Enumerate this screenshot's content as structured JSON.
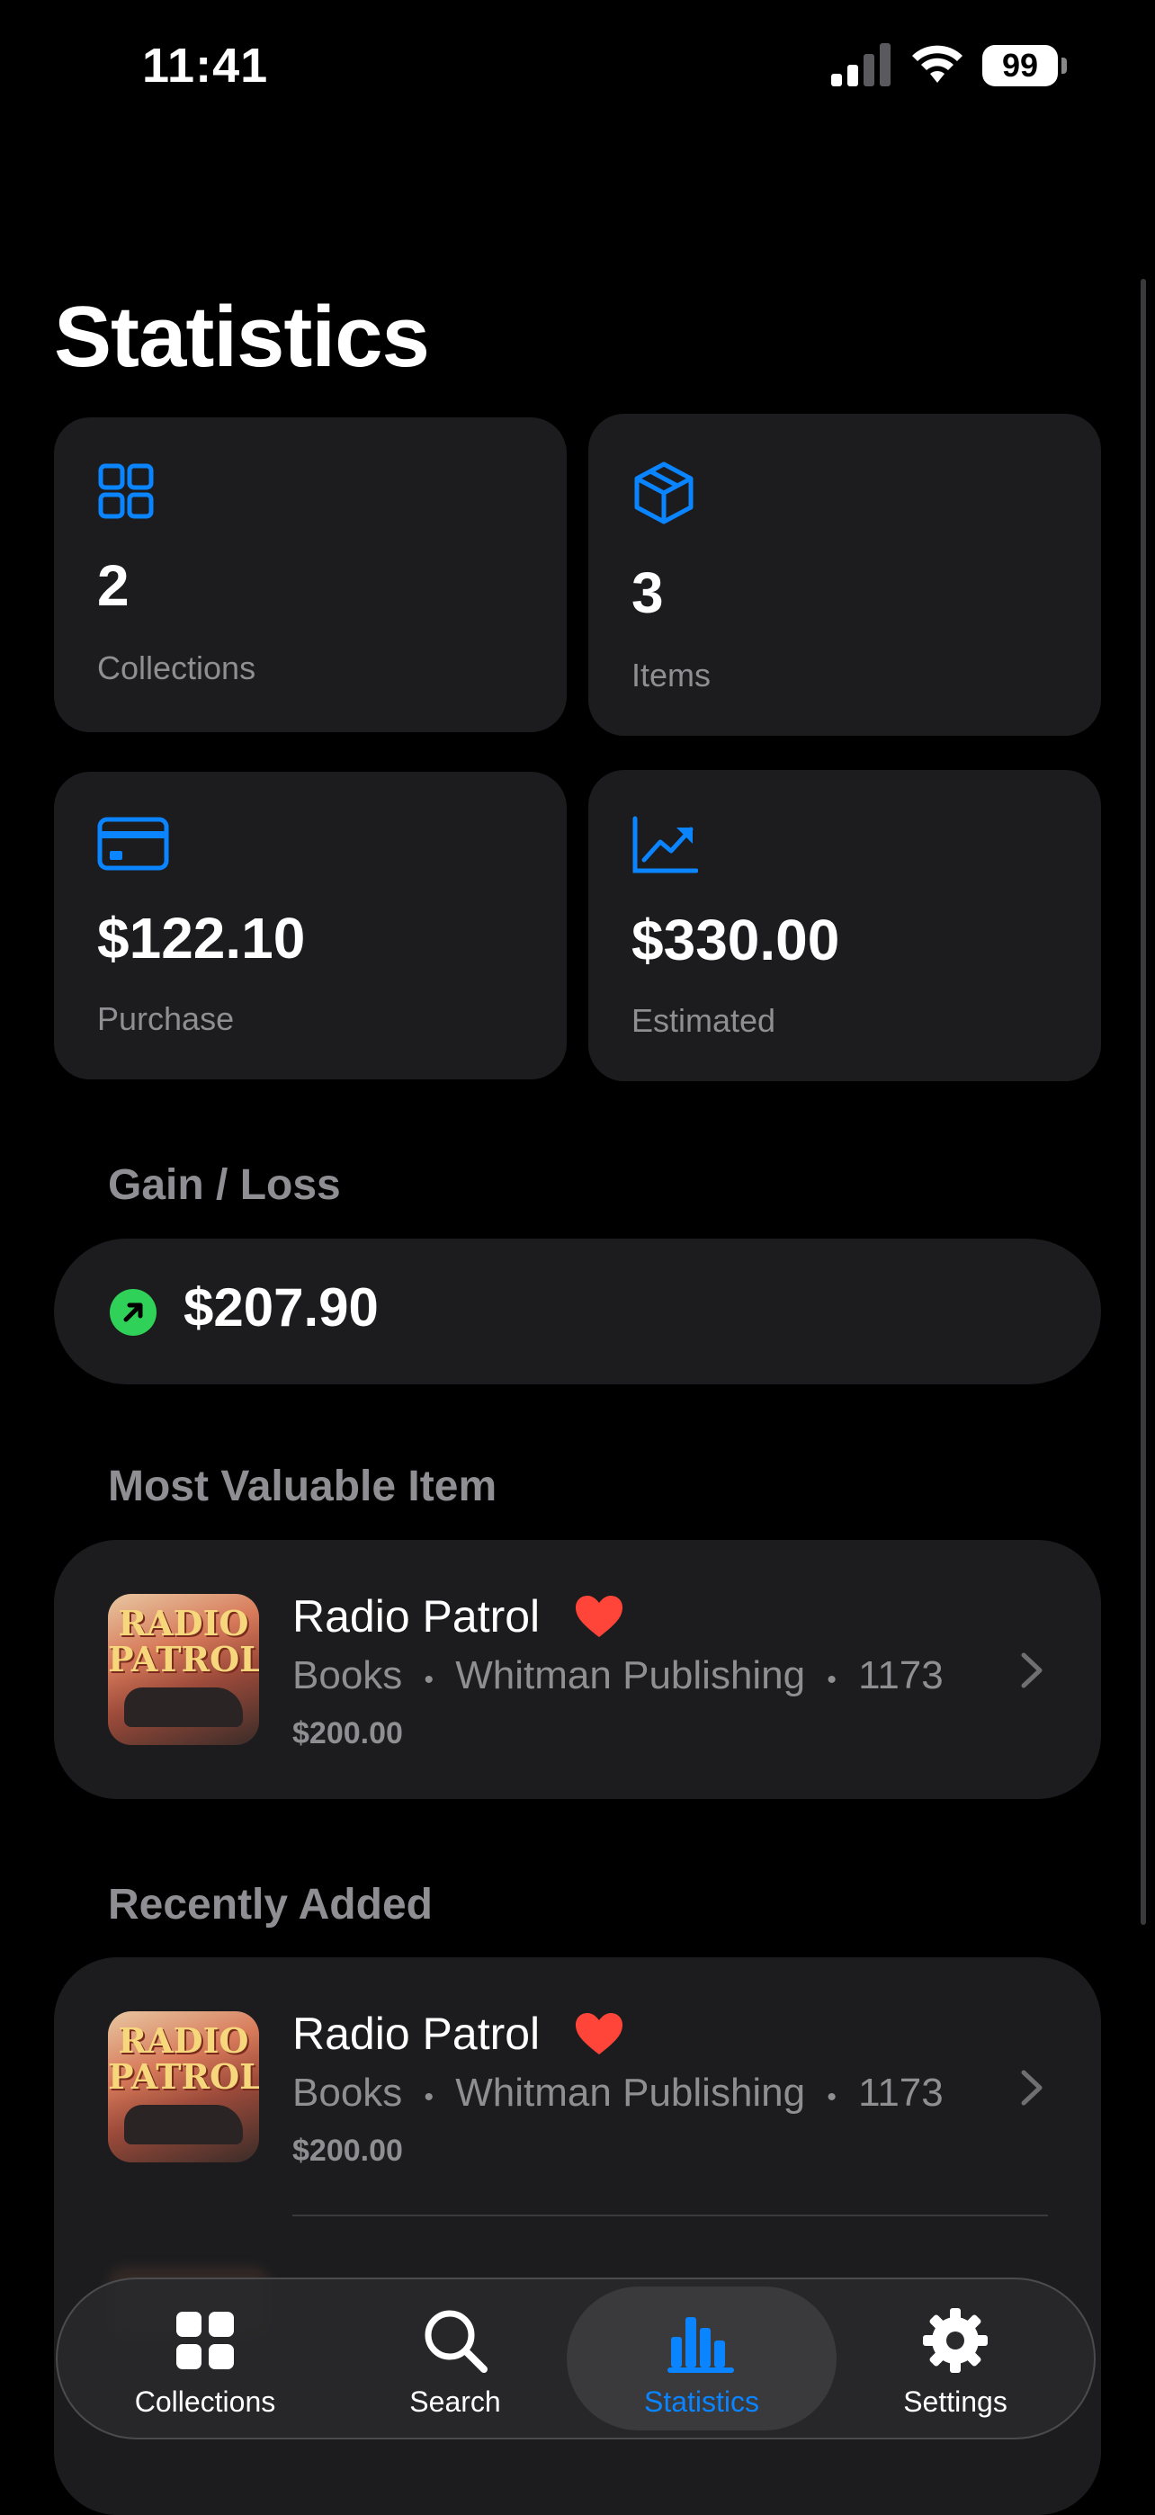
{
  "status_bar": {
    "time": "11:41",
    "battery": "99"
  },
  "page": {
    "title": "Statistics"
  },
  "stats": [
    {
      "value": "2",
      "label": "Collections",
      "icon": "grid-icon"
    },
    {
      "value": "3",
      "label": "Items",
      "icon": "box-icon"
    },
    {
      "value": "$122.10",
      "label": "Purchase",
      "icon": "credit-card-icon"
    },
    {
      "value": "$330.00",
      "label": "Estimated",
      "icon": "trending-up-icon"
    }
  ],
  "gain_loss": {
    "heading": "Gain / Loss",
    "value": "$207.90",
    "icon": "arrow-up-right-icon",
    "color": "#30d158"
  },
  "most_valuable": {
    "heading": "Most Valuable Item",
    "item": {
      "title": "Radio Patrol",
      "category": "Books",
      "publisher": "Whitman Publishing",
      "number": "1173",
      "price": "$200.00",
      "thumb_text_1": "RADIO",
      "thumb_text_2": "PATROL"
    }
  },
  "recently_added": {
    "heading": "Recently Added",
    "items": [
      {
        "title": "Radio Patrol",
        "category": "Books",
        "publisher": "Whitman Publishing",
        "number": "1173",
        "price": "$200.00",
        "thumb_text_1": "RADIO",
        "thumb_text_2": "PATROL"
      }
    ]
  },
  "separator": "•",
  "tab_bar": {
    "tabs": [
      {
        "label": "Collections",
        "icon": "collections-grid-icon"
      },
      {
        "label": "Search",
        "icon": "search-icon"
      },
      {
        "label": "Statistics",
        "icon": "chart-bars-icon",
        "active": true
      },
      {
        "label": "Settings",
        "icon": "gear-icon"
      }
    ]
  },
  "colors": {
    "accent": "#0a84ff",
    "heart": "#ff453a",
    "card": "#1c1c1e"
  }
}
